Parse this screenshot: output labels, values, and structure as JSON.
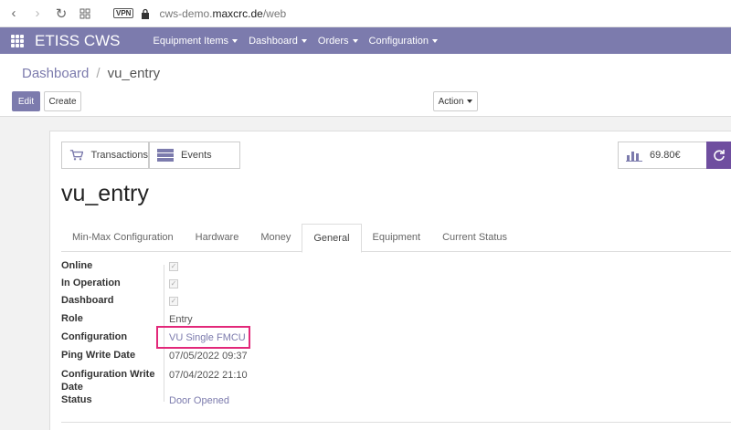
{
  "browser": {
    "vpn_label": "VPN",
    "url_prefix": "cws-demo.",
    "url_domain": "maxcrc.de",
    "url_path": "/web"
  },
  "app": {
    "brand": "ETISS CWS",
    "menu": [
      {
        "label": "Equipment Items"
      },
      {
        "label": "Dashboard"
      },
      {
        "label": "Orders"
      },
      {
        "label": "Configuration"
      }
    ]
  },
  "breadcrumb": {
    "parent": "Dashboard",
    "separator": "/",
    "current": "vu_entry"
  },
  "buttons": {
    "edit": "Edit",
    "create": "Create",
    "action": "Action"
  },
  "smart_buttons": {
    "transactions": "Transactions",
    "events": "Events",
    "amount": "69.80€"
  },
  "record": {
    "title": "vu_entry"
  },
  "tabs": [
    {
      "label": "Min-Max Configuration",
      "active": false
    },
    {
      "label": "Hardware",
      "active": false
    },
    {
      "label": "Money",
      "active": false
    },
    {
      "label": "General",
      "active": true
    },
    {
      "label": "Equipment",
      "active": false
    },
    {
      "label": "Current Status",
      "active": false
    }
  ],
  "fields": {
    "online": {
      "label": "Online",
      "checked": true
    },
    "in_operation": {
      "label": "In Operation",
      "checked": true
    },
    "dashboard": {
      "label": "Dashboard",
      "checked": true
    },
    "role": {
      "label": "Role",
      "value": "Entry"
    },
    "configuration": {
      "label": "Configuration",
      "value": "VU Single FMCU"
    },
    "ping_write_date": {
      "label": "Ping Write Date",
      "value": "07/05/2022 09:37"
    },
    "configuration_write_date": {
      "label": "Configuration Write Date",
      "value": "07/04/2022 21:10"
    },
    "status": {
      "label": "Status",
      "value": "Door Opened"
    }
  },
  "colors": {
    "brand": "#7c7bad",
    "refresh": "#6f4e9f",
    "highlight": "#e2287a"
  }
}
